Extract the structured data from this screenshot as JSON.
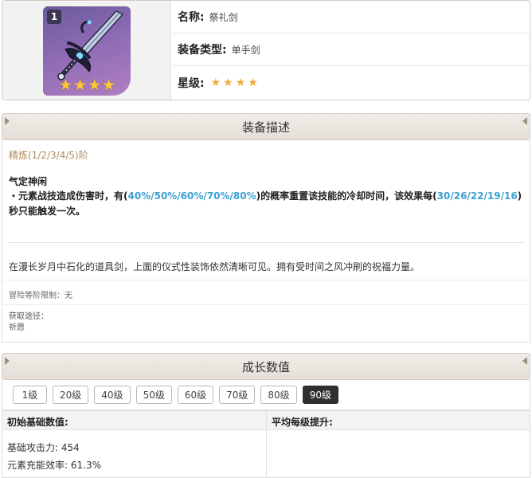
{
  "weapon": {
    "refine_badge": "1",
    "name_label": "名称:",
    "name_value": "祭礼剑",
    "type_label": "装备类型:",
    "type_value": "单手剑",
    "rarity_label": "星级:",
    "rarity": 4,
    "star_glyph": "★",
    "colors": {
      "frame_top": "#6a5a99",
      "frame_bottom": "#b17fc0",
      "star": "#f2a93b"
    }
  },
  "description": {
    "header": "装备描述",
    "refine_line": "精炼(1/2/3/4/5)阶",
    "passive_name": "气定神闲",
    "passive_pre": "・元素战技造成伤害时，有(",
    "passive_chance": "40%/50%/60%/70%/80%",
    "passive_mid": ")的概率重置该技能的冷却时间，该效果每(",
    "passive_cd": "30/26/22/19/16",
    "passive_post": ")秒只能触发一次。",
    "flavor": "在漫长岁月中石化的道具剑，上面的仪式性装饰依然清晰可见。拥有受时间之风冲刷的祝福力量。",
    "ar_limit": "冒险等阶限制：无",
    "source_label": "获取途径：",
    "source_value": "祈愿",
    "highlight_color": "#3aa0d2"
  },
  "growth": {
    "header": "成长数值",
    "levels": [
      "1级",
      "20级",
      "40级",
      "50级",
      "60级",
      "70级",
      "80级",
      "90级"
    ],
    "active_level": "90级",
    "col_base": "初始基础数值:",
    "col_increase": "平均每级提升:",
    "atk_label": "基础攻击力:",
    "atk_value": "454",
    "er_label": "元素充能效率:",
    "er_value": "61.3%"
  }
}
